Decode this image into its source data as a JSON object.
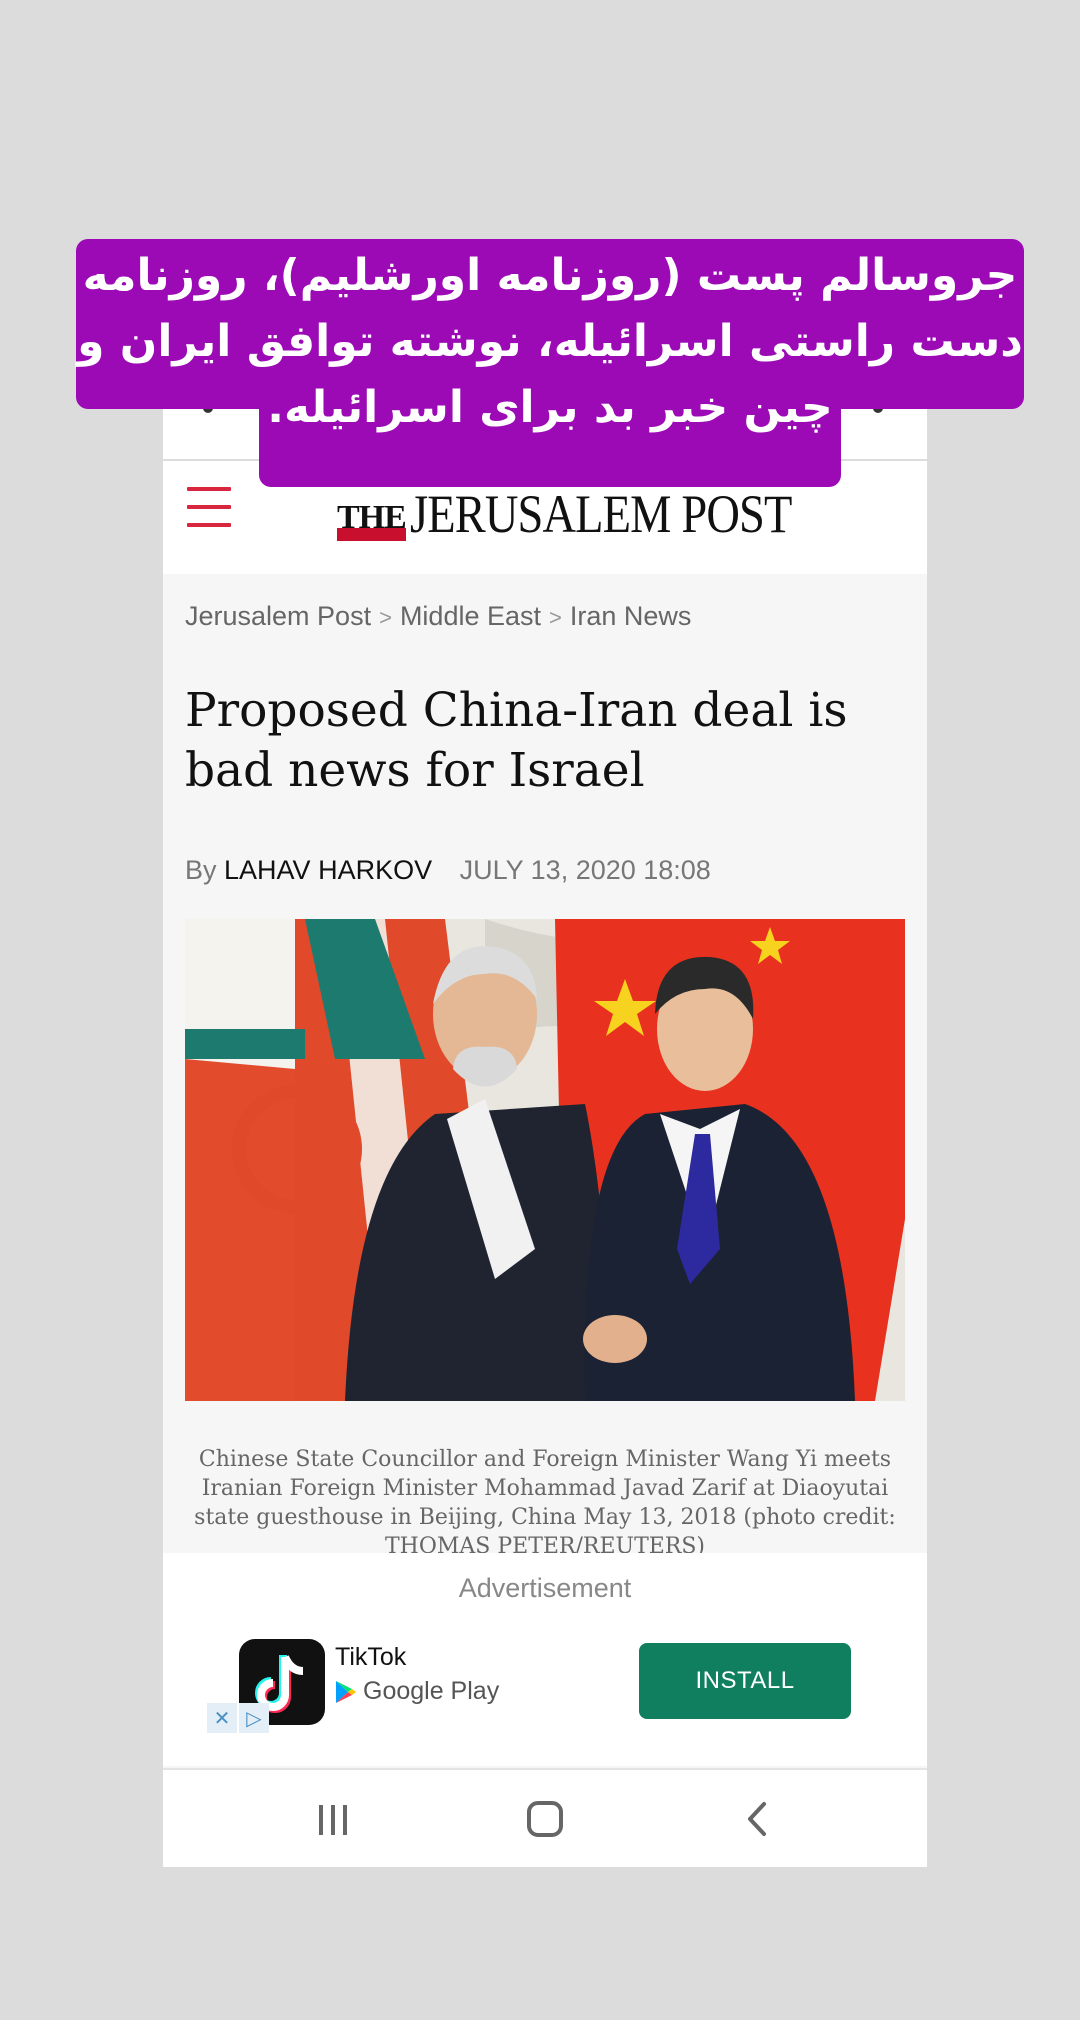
{
  "overlay": {
    "lines": [
      "جروسالم پست (روزنامه اورشلیم)، روزنامه",
      "دست راستی اسرائیله، نوشته توافق ایران و",
      "چین خبر بد برای اسرائیله."
    ],
    "color": "#9b0ab5"
  },
  "site": {
    "logo_prefix": "THE",
    "logo_name": "JERUSALEM POST",
    "accent": "#c8102e"
  },
  "breadcrumb": [
    "Jerusalem Post",
    "Middle East",
    "Iran News"
  ],
  "article": {
    "headline": "Proposed China-Iran deal is bad news for Israel",
    "by_label": "By",
    "author": "LAHAV HARKOV",
    "date": "JULY 13, 2020 18:08",
    "caption": "Chinese State Councillor and Foreign Minister Wang Yi meets Iranian Foreign Minister Mohammad Javad Zarif at Diaoyutai state guesthouse in Beijing, China May 13, 2018 (photo credit: THOMAS PETER/REUTERS)"
  },
  "ad": {
    "label": "Advertisement",
    "app_name": "TikTok",
    "store": "Google Play",
    "install_label": "INSTALL",
    "install_color": "#0f7f5f",
    "close_icon": "close-icon",
    "adchoices_icon": "adchoices-icon"
  },
  "navbar": {
    "icons": [
      "recent-apps-icon",
      "home-icon",
      "back-icon"
    ]
  }
}
